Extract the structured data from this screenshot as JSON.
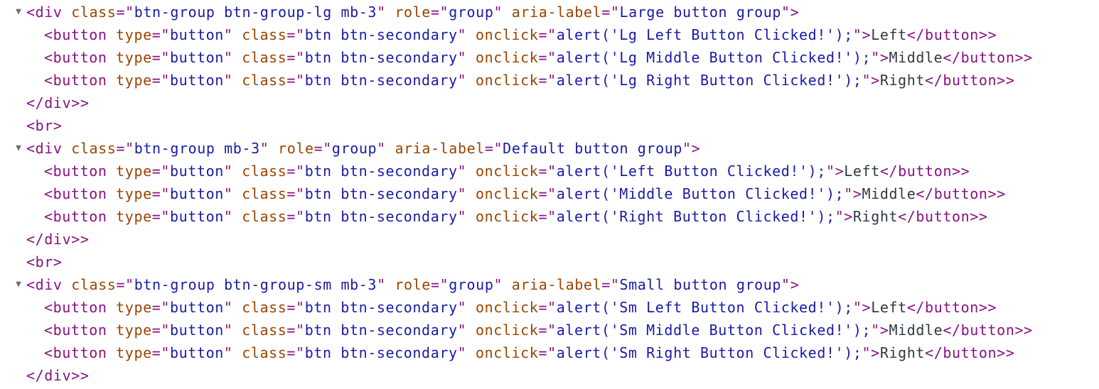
{
  "groups": [
    {
      "tag_open": "<div",
      "tag_close": "</div>",
      "class_value": "btn-group btn-group-lg mb-3",
      "role_value": "group",
      "aria_label_value": "Large button group",
      "buttons": [
        {
          "onclick": "alert('Lg Left Button Clicked!');",
          "label": "Left"
        },
        {
          "onclick": "alert('Lg Middle Button Clicked!');",
          "label": "Middle"
        },
        {
          "onclick": "alert('Lg Right Button Clicked!');",
          "label": "Right"
        }
      ]
    },
    {
      "tag_open": "<div",
      "tag_close": "</div>",
      "class_value": "btn-group mb-3",
      "role_value": "group",
      "aria_label_value": "Default button group",
      "buttons": [
        {
          "onclick": "alert('Left Button Clicked!');",
          "label": "Left"
        },
        {
          "onclick": "alert('Middle Button Clicked!');",
          "label": "Middle"
        },
        {
          "onclick": "alert('Right Button Clicked!');",
          "label": "Right"
        }
      ]
    },
    {
      "tag_open": "<div",
      "tag_close": "</div>",
      "class_value": "btn-group btn-group-sm mb-3",
      "role_value": "group",
      "aria_label_value": "Small button group",
      "buttons": [
        {
          "onclick": "alert('Sm Left Button Clicked!');",
          "label": "Left"
        },
        {
          "onclick": "alert('Sm Middle Button Clicked!');",
          "label": "Middle"
        },
        {
          "onclick": "alert('Sm Right Button Clicked!');",
          "label": "Right"
        }
      ]
    }
  ],
  "br_tag": "<br>",
  "toggle_glyph": "▼",
  "button_tag_open": "<button",
  "button_tag_close": "</button>",
  "attr": {
    "type": "type",
    "type_value": "button",
    "class": "class",
    "button_class_value": "btn btn-secondary",
    "onclick": "onclick",
    "role": "role",
    "aria_label": "aria-label"
  },
  "icons": {
    "toggle": "expand-triangle-icon"
  }
}
